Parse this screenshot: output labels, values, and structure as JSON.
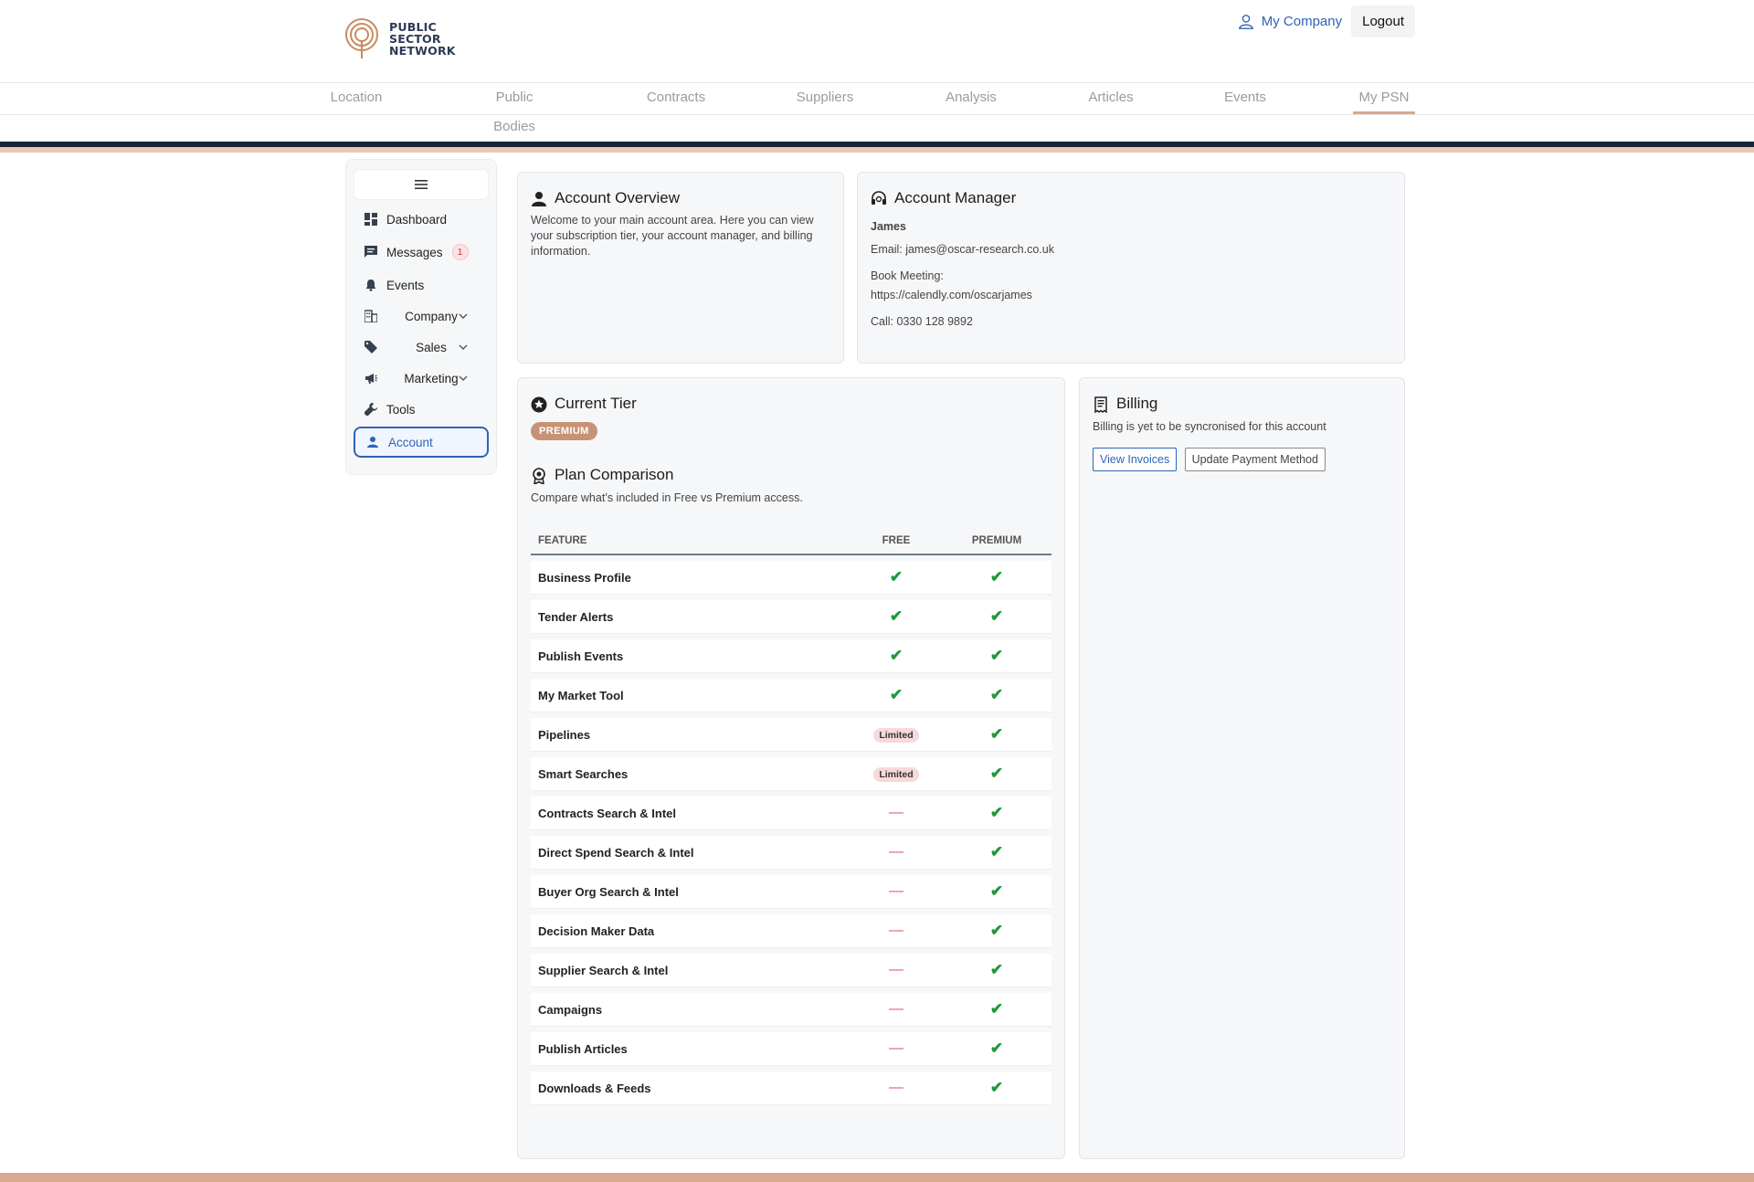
{
  "logo": {
    "line1": "PUBLIC",
    "line2": "SECTOR",
    "line3": "NETWORK"
  },
  "top_links": {
    "company": "My Company",
    "logout": "Logout"
  },
  "nav": [
    "Location",
    "Public Bodies",
    "Contracts",
    "Suppliers",
    "Analysis",
    "Articles",
    "Events",
    "My PSN"
  ],
  "sidebar": {
    "items": [
      {
        "label": "Dashboard"
      },
      {
        "label": "Messages",
        "badge": "1"
      },
      {
        "label": "Events"
      },
      {
        "label": "Company"
      },
      {
        "label": "Sales"
      },
      {
        "label": "Marketing"
      },
      {
        "label": "Tools"
      },
      {
        "label": "Account"
      }
    ]
  },
  "overview": {
    "title": "Account Overview",
    "text": "Welcome to your main account area. Here you can view your subscription tier, your account manager, and billing information."
  },
  "manager": {
    "title": "Account Manager",
    "name": "James",
    "email": "Email: james@oscar-research.co.uk",
    "book_label": "Book Meeting:",
    "book_url": "https://calendly.com/oscarjames",
    "call": "Call: 0330 128 9892"
  },
  "tier": {
    "title": "Current Tier",
    "badge": "PREMIUM",
    "plan_title": "Plan Comparison",
    "plan_sub": "Compare what’s included in Free vs Premium access.",
    "headers": [
      "FEATURE",
      "FREE",
      "PREMIUM"
    ],
    "rows": [
      {
        "feature": "Business Profile",
        "free": "✔",
        "premium": "✔"
      },
      {
        "feature": "Tender Alerts",
        "free": "✔",
        "premium": "✔"
      },
      {
        "feature": "Publish Events",
        "free": "✔",
        "premium": "✔"
      },
      {
        "feature": "My Market Tool",
        "free": "✔",
        "premium": "✔"
      },
      {
        "feature": "Pipelines",
        "free": "Limited",
        "premium": "✔"
      },
      {
        "feature": "Smart Searches",
        "free": "Limited",
        "premium": "✔"
      },
      {
        "feature": "Contracts Search & Intel",
        "free": "—",
        "premium": "✔"
      },
      {
        "feature": "Direct Spend Search & Intel",
        "free": "—",
        "premium": "✔"
      },
      {
        "feature": "Buyer Org Search & Intel",
        "free": "—",
        "premium": "✔"
      },
      {
        "feature": "Decision Maker Data",
        "free": "—",
        "premium": "✔"
      },
      {
        "feature": "Supplier Search & Intel",
        "free": "—",
        "premium": "✔"
      },
      {
        "feature": "Campaigns",
        "free": "—",
        "premium": "✔"
      },
      {
        "feature": "Publish Articles",
        "free": "—",
        "premium": "✔"
      },
      {
        "feature": "Downloads & Feeds",
        "free": "—",
        "premium": "✔"
      }
    ]
  },
  "billing": {
    "title": "Billing",
    "text": "Billing is yet to be syncronised for this account",
    "view_invoices": "View Invoices",
    "update_payment": "Update Payment Method"
  }
}
